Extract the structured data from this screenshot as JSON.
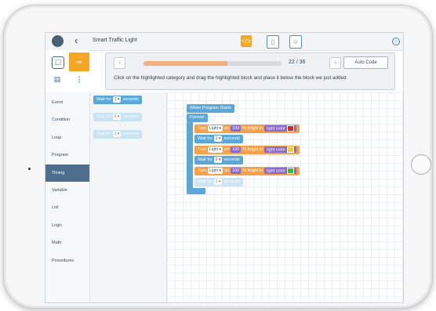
{
  "app": {
    "title": "Smart Traffic Light"
  },
  "toolbar": {
    "code_icon": "</>",
    "device_icon": "▯",
    "sim_icon": "☺",
    "menu_icon": "○",
    "back_icon": "‹"
  },
  "tools": {
    "t1": "☐",
    "t2": "⇒",
    "t3": "▤",
    "t4": "⋮"
  },
  "hint": {
    "prev_icon": "‹",
    "next_icon": "›",
    "progress_text": "22 / 36",
    "progress_fraction": 0.61,
    "auto_code_label": "Auto Code",
    "text": "Click on the highlighted category and drag the highlighted block and place it below the block we just added"
  },
  "categories": [
    {
      "label": "Event"
    },
    {
      "label": "Condition"
    },
    {
      "label": "Loop"
    },
    {
      "label": "Program"
    },
    {
      "label": "Timing",
      "active": true
    },
    {
      "label": "Variable"
    },
    {
      "label": "List"
    },
    {
      "label": "Logic"
    },
    {
      "label": "Math"
    },
    {
      "label": "Procedures"
    }
  ],
  "flyout": [
    {
      "prefix": "Wait for",
      "value": "1 ▾",
      "suffix": "seconds"
    },
    {
      "prefix": "Wait for",
      "value": "2 ▾",
      "suffix": "seconds"
    },
    {
      "prefix": "Wait for",
      "value": "1 ▾",
      "suffix": "seconds"
    }
  ],
  "program": {
    "start": "When Program Starts",
    "forever": "Forever",
    "turn_prefix": "Turn",
    "light_value": "Light ▾",
    "on_text": "on",
    "pct_value": "100",
    "pct_suffix": "%",
    "brightness_text": "bright in",
    "color_label": "light color",
    "colors": [
      "#e02020",
      "#f5d020",
      "#30c030"
    ],
    "wait_prefix": "Wait for",
    "wait_values": [
      "1 ▾",
      "2 ▾",
      "1 ▾"
    ],
    "wait_suffix": "seconds"
  }
}
